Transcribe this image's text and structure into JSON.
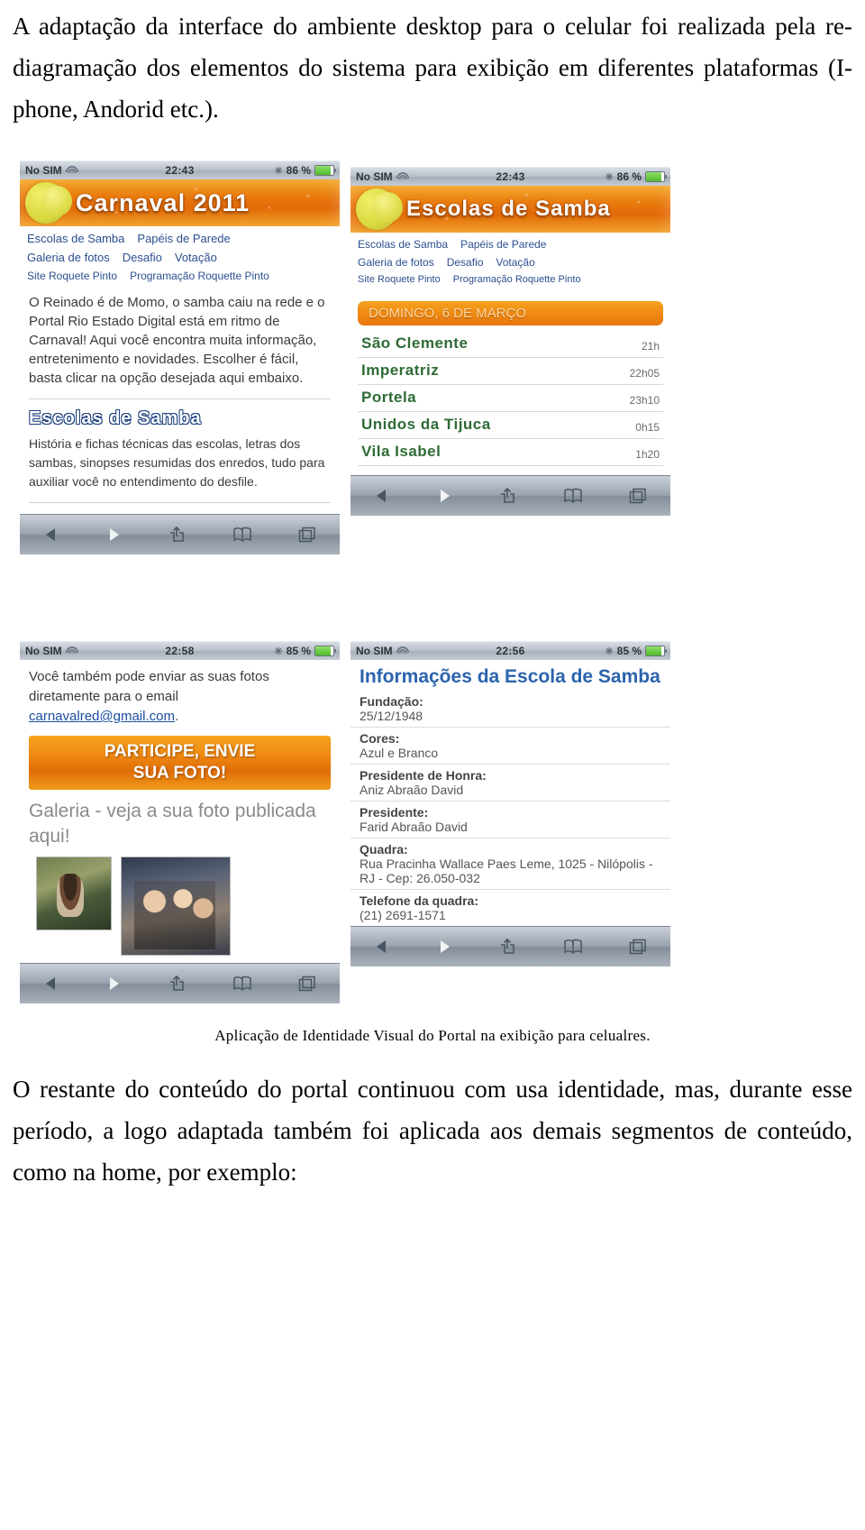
{
  "intro_paragraph": "A adaptação da interface do ambiente desktop para o celular foi realizada pela re-diagramação dos elementos do sistema para exibição em diferentes plataformas (I-phone, Andorid etc.).",
  "closing_paragraph": "O restante do conteúdo do portal continuou com usa identidade, mas, durante esse período, a logo adaptada também foi aplicada aos demais segmentos de conteúdo, como na home, por exemplo:",
  "caption": "Aplicação de Identidade Visual do Portal na exibição para celualres.",
  "colors": {
    "banner_orange": "#e8770d",
    "link_blue": "#2b4f8f",
    "title_green": "#2e6b35",
    "info_title_blue": "#2b63ad"
  },
  "toolbar": {
    "icons": [
      {
        "name": "back-icon",
        "glyph": "◀"
      },
      {
        "name": "forward-icon",
        "glyph": "▶"
      },
      {
        "name": "share-icon",
        "glyph": "share"
      },
      {
        "name": "bookmarks-icon",
        "glyph": "book"
      },
      {
        "name": "tabs-icon",
        "glyph": "tabs"
      }
    ]
  },
  "phones": [
    {
      "id": "phone-home",
      "status": {
        "carrier": "No SIM",
        "wifi": "wifi-icon",
        "time": "22:43",
        "bluetooth": "bluetooth-icon",
        "battery_label": "86 %",
        "battery_pct": 86
      },
      "banner_title": "Carnaval 2011",
      "nav_rows": [
        [
          "Escolas de Samba",
          "Papéis de Parede"
        ],
        [
          "Galeria de fotos",
          "Desafio",
          "Votação"
        ],
        [
          "Site Roquete Pinto",
          "Programação Roquette Pinto"
        ]
      ],
      "body_text": "O Reinado é de Momo, o samba caiu na rede e o Portal Rio Estado Digital está em ritmo de Carnaval! Aqui você encontra muita informação, entretenimento e novidades. Escolher é fácil, basta clicar na opção desejada aqui embaixo.",
      "section_title": "Escolas de Samba",
      "section_text": "História e fichas técnicas das escolas, letras dos sambas, sinopses resumidas dos enredos, tudo para auxiliar você no entendimento do desfile."
    },
    {
      "id": "phone-escolas",
      "status": {
        "carrier": "No SIM",
        "wifi": "wifi-icon",
        "time": "22:43",
        "bluetooth": "bluetooth-icon",
        "battery_label": "86 %",
        "battery_pct": 86
      },
      "banner_title": "Escolas de Samba",
      "nav_rows": [
        [
          "Escolas de Samba",
          "Papéis de Parede"
        ],
        [
          "Galeria de fotos",
          "Desafio",
          "Votação"
        ],
        [
          "Site Roquete Pinto",
          "Programação Roquette Pinto"
        ]
      ],
      "date_bar": "DOMINGO, 6 DE MARÇO",
      "schools": [
        {
          "name": "São Clemente",
          "time": "21h"
        },
        {
          "name": "Imperatriz",
          "time": "22h05"
        },
        {
          "name": "Portela",
          "time": "23h10"
        },
        {
          "name": "Unidos da Tijuca",
          "time": "0h15"
        },
        {
          "name": "Vila Isabel",
          "time": "1h20"
        }
      ]
    },
    {
      "id": "phone-galeria",
      "status": {
        "carrier": "No SIM",
        "wifi": "wifi-icon",
        "time": "22:58",
        "bluetooth": "bluetooth-icon",
        "battery_label": "85 %",
        "battery_pct": 85
      },
      "email_text_before": "Você também pode enviar as suas fotos diretamente para o email ",
      "email_link": "carnavalred@gmail.com",
      "email_text_after": ".",
      "participate_line1": "PARTICIPE, ENVIE",
      "participate_line2": "SUA FOTO!",
      "gallery_text": "Galeria - veja a sua foto publicada aqui!",
      "photos": [
        {
          "name": "photo-thumb-1"
        },
        {
          "name": "photo-thumb-2"
        }
      ]
    },
    {
      "id": "phone-info",
      "status": {
        "carrier": "No SIM",
        "wifi": "wifi-icon",
        "time": "22:56",
        "bluetooth": "bluetooth-icon",
        "battery_label": "85 %",
        "battery_pct": 85
      },
      "info_title": "Informações da Escola de Samba",
      "info_items": [
        {
          "label": "Fundação:",
          "value": "25/12/1948"
        },
        {
          "label": "Cores:",
          "value": "Azul e Branco"
        },
        {
          "label": "Presidente de Honra:",
          "value": "Aniz Abraão David"
        },
        {
          "label": "Presidente:",
          "value": "Farid Abraão David"
        },
        {
          "label": "Quadra:",
          "value": "Rua Pracinha Wallace Paes Leme, 1025 - Nilópolis - RJ - Cep: 26.050-032"
        },
        {
          "label": "Telefone da quadra:",
          "value": "(21) 2691-1571"
        }
      ]
    }
  ]
}
